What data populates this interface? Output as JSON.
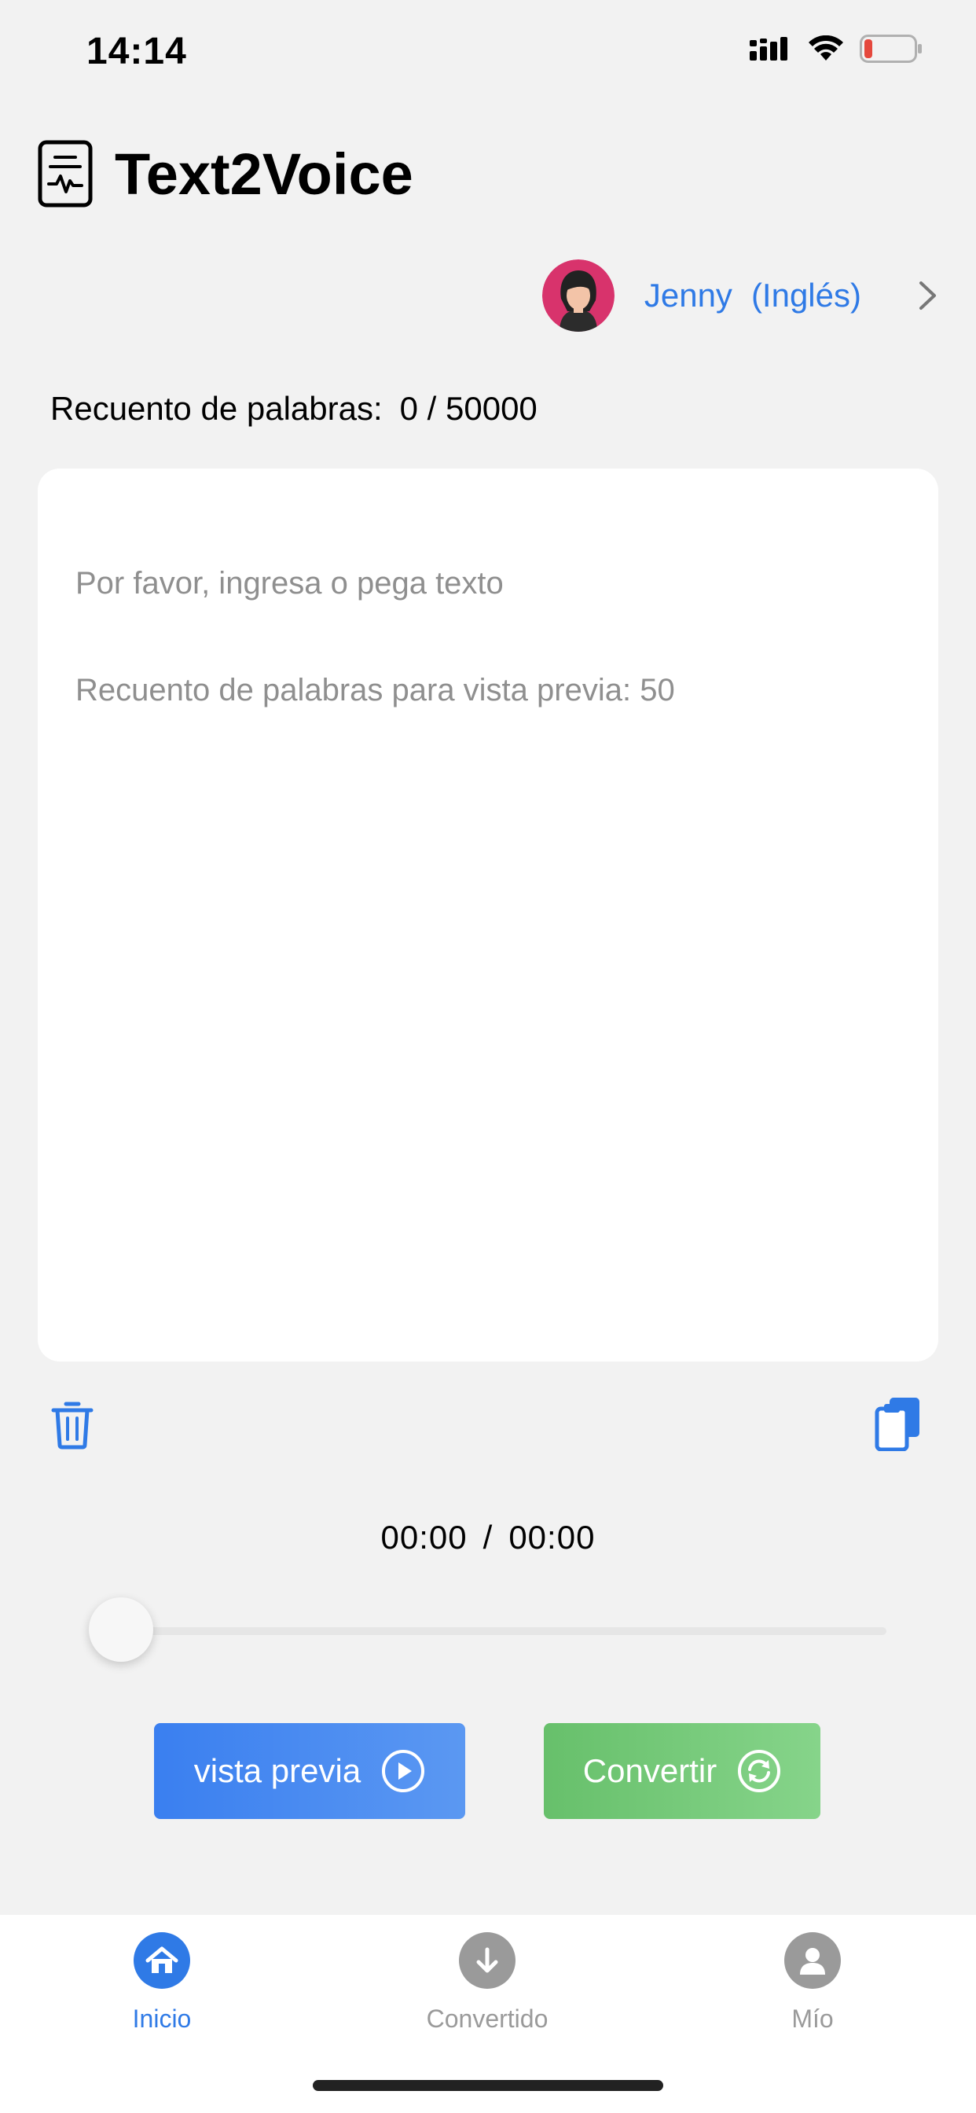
{
  "status_bar": {
    "time": "14:14",
    "battery_color": "#e5483d"
  },
  "header": {
    "title": "Text2Voice",
    "logo_icon": "document-waveform-icon"
  },
  "voice": {
    "name": "Jenny",
    "language": "(Inglés)",
    "accent": "#2f7ae6"
  },
  "word_count": {
    "label": "Recuento de palabras:",
    "value": "0 / 50000"
  },
  "editor": {
    "placeholder_line1": "Por favor, ingresa o pega texto",
    "placeholder_line2": "Recuento de palabras para vista previa: 50"
  },
  "player": {
    "current": "00:00",
    "separator": "/",
    "total": "00:00",
    "progress": 0
  },
  "actions": {
    "preview_label": "vista previa",
    "convert_label": "Convertir",
    "preview_color": "#3a7ff0",
    "convert_color": "#67c06b"
  },
  "tabs": [
    {
      "label": "Inicio",
      "icon": "home-icon",
      "active": true
    },
    {
      "label": "Convertido",
      "icon": "download-icon",
      "active": false
    },
    {
      "label": "Mío",
      "icon": "user-icon",
      "active": false
    }
  ],
  "colors": {
    "active_tab": "#2f7ae6",
    "inactive_tab": "#9a9a9a"
  }
}
